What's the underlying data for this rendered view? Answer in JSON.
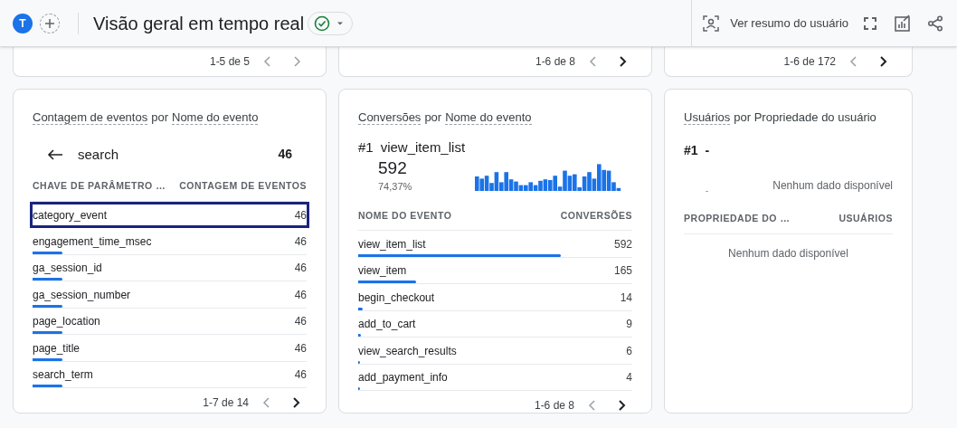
{
  "header": {
    "avatar": "T",
    "title": "Visão geral em tempo real",
    "user_snapshot": "Ver resumo do usuário"
  },
  "top_cards": [
    {
      "pager": {
        "label": "1-5 de 5",
        "prev_enabled": false,
        "next_enabled": false
      }
    },
    {
      "pager": {
        "label": "1-6 de 8",
        "prev_enabled": false,
        "next_enabled": true
      }
    },
    {
      "pager": {
        "label": "1-6 de 172",
        "prev_enabled": false,
        "next_enabled": true
      }
    }
  ],
  "cards": [
    {
      "kind": "drilldown",
      "title": [
        {
          "text": "Contagem de eventos",
          "dashed": true
        },
        {
          "text": "por",
          "dashed": false
        },
        {
          "text": "Nome do evento",
          "dashed": true
        }
      ],
      "back_label": "search",
      "back_value": "46",
      "columns": [
        "CHAVE DE PARÂMETRO …",
        "CONTAGEM DE EVENTOS"
      ],
      "rows": [
        {
          "name": "category_event",
          "value": "46",
          "highlighted": true
        },
        {
          "name": "engagement_time_msec",
          "value": "46",
          "level": 0.11,
          "highlighted": false
        },
        {
          "name": "ga_session_id",
          "value": "46",
          "level": 0.11,
          "highlighted": false
        },
        {
          "name": "ga_session_number",
          "value": "46",
          "level": 0.11,
          "highlighted": false
        },
        {
          "name": "page_location",
          "value": "46",
          "level": 0.11,
          "highlighted": false
        },
        {
          "name": "page_title",
          "value": "46",
          "level": 0.11,
          "highlighted": false
        },
        {
          "name": "search_term",
          "value": "46",
          "level": 0.11,
          "highlighted": false
        }
      ],
      "pager": {
        "label": "1-7 de 14",
        "prev_enabled": false,
        "next_enabled": true
      }
    },
    {
      "kind": "top",
      "title": [
        {
          "text": "Conversões",
          "dashed": true
        },
        {
          "text": "por",
          "dashed": false
        },
        {
          "text": "Nome do evento",
          "dashed": true
        }
      ],
      "rank": "#1",
      "top_name": "view_item_list",
      "top_value": "592",
      "top_share": "74,37%",
      "sparkline": true,
      "columns": [
        "NOME DO EVENTO",
        "CONVERSÕES"
      ],
      "rows": [
        {
          "name": "view_item_list",
          "value": "592",
          "level": 0.74,
          "highlighted": false
        },
        {
          "name": "view_item",
          "value": "165",
          "level": 0.21,
          "highlighted": false
        },
        {
          "name": "begin_checkout",
          "value": "14",
          "level": 0.018,
          "highlighted": false
        },
        {
          "name": "add_to_cart",
          "value": "9",
          "level": 0.011,
          "highlighted": false
        },
        {
          "name": "view_search_results",
          "value": "6",
          "level": 0.008,
          "highlighted": false
        },
        {
          "name": "add_payment_info",
          "value": "4",
          "level": 0.005,
          "highlighted": false
        }
      ],
      "pager": {
        "label": "1-6 de 8",
        "prev_enabled": false,
        "next_enabled": true
      }
    },
    {
      "kind": "empty",
      "title": [
        {
          "text": "Usuários",
          "dashed": true
        },
        {
          "text": "por Propriedade do usuário",
          "dashed": false
        }
      ],
      "rank": "#1",
      "top_name": "-",
      "top_share": "-",
      "chart_empty": "Nenhum dado disponível",
      "columns": [
        "PROPRIEDADE DO …",
        "USUÁRIOS"
      ],
      "empty": "Nenhum dado disponível"
    }
  ]
}
